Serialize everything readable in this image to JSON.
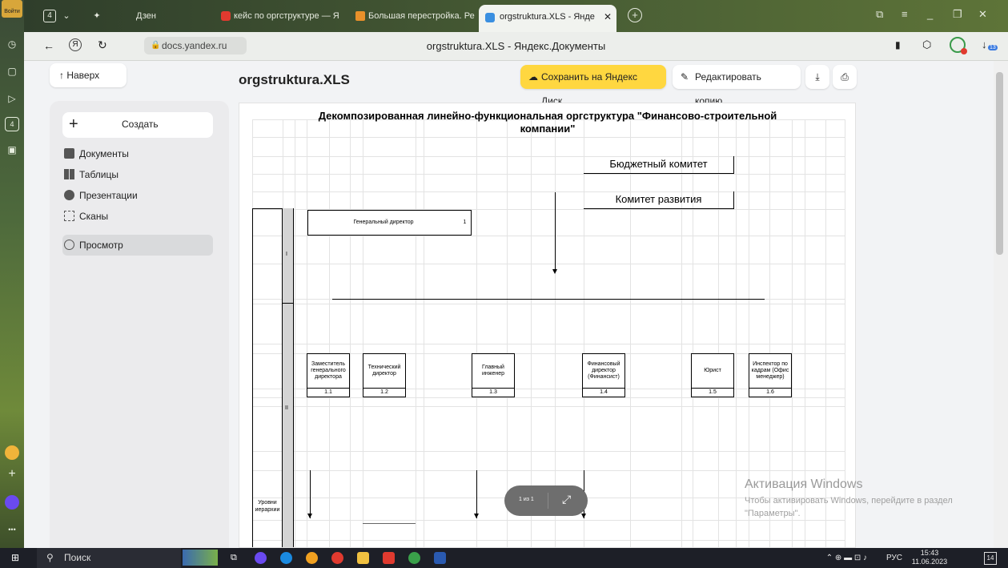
{
  "browser": {
    "login_label": "Войти",
    "tab_count": "4",
    "tabs": [
      {
        "label": "Дзен"
      },
      {
        "label": "кейс по оргструктуре — Я"
      },
      {
        "label": "Большая перестройка. Ре"
      },
      {
        "label": "orgstruktura.XLS - Янде"
      }
    ],
    "url": "docs.yandex.ru",
    "page_title": "orgstruktura.XLS - Яндекс.Документы",
    "download_badge": "13"
  },
  "toolbar": {
    "back_label": "↑ Наверх",
    "doc_name": "orgstruktura.XLS",
    "save_label": "Сохранить на Яндекс Диск",
    "edit_label": "Редактировать копию"
  },
  "sidebar": {
    "create_label": "Создать",
    "items": [
      {
        "label": "Документы"
      },
      {
        "label": "Таблицы"
      },
      {
        "label": "Презентации"
      },
      {
        "label": "Сканы"
      },
      {
        "label": "Просмотр"
      }
    ]
  },
  "sheet": {
    "title_line1": "Декомпозированная линейно-функциональная оргструктура \"Финансово-строительной",
    "title_line2": "компании\"",
    "budget_committee": "Бюджетный комитет",
    "development_committee": "Комитет развития",
    "ceo": {
      "label": "Генеральный директор",
      "code": "1"
    },
    "level_1": "I",
    "level_2": "II",
    "levels_label": "Уровни иерархии",
    "positions": [
      {
        "label": "Заместитель генерального директора",
        "code": "1.1"
      },
      {
        "label": "Технический директор",
        "code": "1.2"
      },
      {
        "label": "Главный инженер",
        "code": "1.3"
      },
      {
        "label": "Финансовый директор (Финансист)",
        "code": "1.4"
      },
      {
        "label": "Юрист",
        "code": "1.5"
      },
      {
        "label": "Инспектор по кадрам (Офис менеджер)",
        "code": "1.6"
      }
    ]
  },
  "pager": {
    "label": "1 из 1"
  },
  "watermark": {
    "title": "Активация Windows",
    "text": "Чтобы активировать Windows, перейдите в раздел \"Параметры\"."
  },
  "taskbar": {
    "search_label": "Поиск",
    "lang": "РУС",
    "time": "15:43",
    "date": "11.06.2023",
    "notifications": "14"
  }
}
